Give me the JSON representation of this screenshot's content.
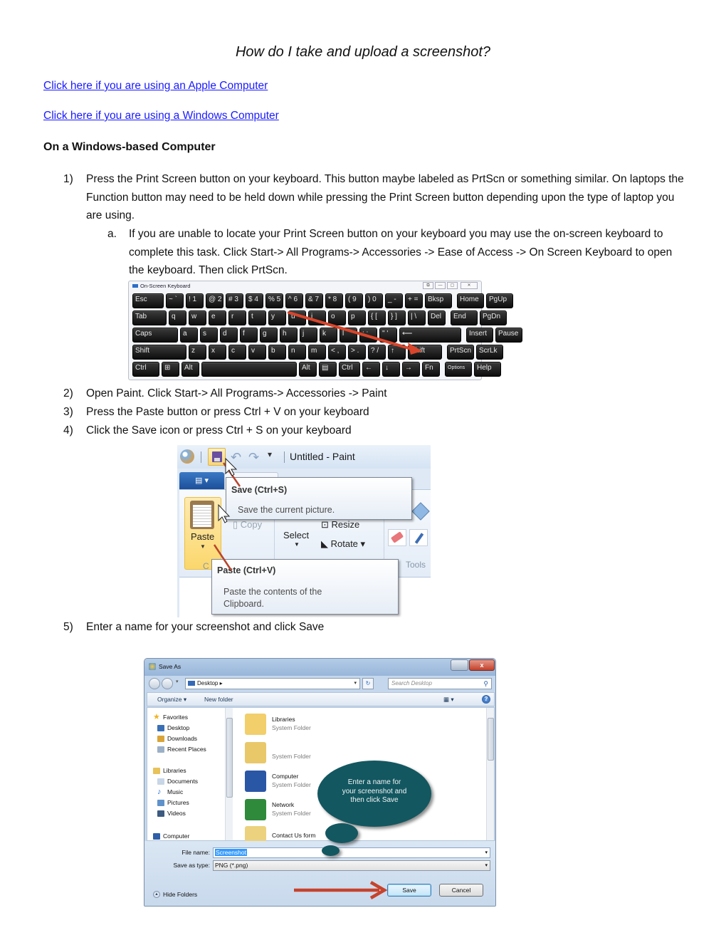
{
  "document": {
    "title": "How do I take and upload a screenshot?",
    "links": [
      {
        "label": "Click here if you are using an Apple Computer"
      },
      {
        "label": "Click here if you are using a Windows Computer"
      }
    ],
    "section_heading": "On a Windows-based Computer",
    "steps": [
      {
        "num": "1)",
        "text": "Press the Print Screen button on your keyboard. This button maybe labeled as PrtScn or something similar. On laptops the Function button may need to be held down while pressing the Print Screen button depending upon the type of laptop you are using."
      },
      {
        "num": "2)",
        "text": "Open Paint. Click Start-> All Programs-> Accessories -> Paint"
      },
      {
        "num": "3)",
        "text": "Press the Paste button or press Ctrl + V on your keyboard"
      },
      {
        "num": "4)",
        "text": "Click the Save icon or press Ctrl + S on your keyboard"
      },
      {
        "num": "5)",
        "text": "Enter a name for your screenshot and click Save"
      }
    ],
    "substep": {
      "num": "a.",
      "text": "If you are unable to locate your Print Screen button on your keyboard you may use the on-screen keyboard to complete this task. Click Start-> All Programs-> Accessories -> Ease of Access -> On Screen Keyboard to open the keyboard. Then click PrtScn."
    }
  },
  "keyboard": {
    "window_title": "On-Screen Keyboard",
    "highlight_color": "#d9452b",
    "rows": [
      [
        "Esc",
        "~ `",
        "! 1",
        "@ 2",
        "# 3",
        "$ 4",
        "% 5",
        "^ 6",
        "& 7",
        "* 8",
        "( 9",
        ") 0",
        "_ -",
        "+ =",
        "Bksp",
        "Home",
        "PgUp"
      ],
      [
        "Tab",
        "q",
        "w",
        "e",
        "r",
        "t",
        "y",
        "u",
        "i",
        "o",
        "p",
        "{ [",
        "} ]",
        "| \\",
        "Del",
        "End",
        "PgDn"
      ],
      [
        "Caps",
        "a",
        "s",
        "d",
        "f",
        "g",
        "h",
        "j",
        "k",
        "l",
        ": ;",
        "\" '",
        "⟵",
        "Insert",
        "Pause"
      ],
      [
        "Shift",
        "z",
        "x",
        "c",
        "v",
        "b",
        "n",
        "m",
        "< ,",
        "> .",
        "? /",
        "↑",
        "Shift",
        "PrtScn",
        "ScrLk"
      ],
      [
        "Ctrl",
        "⊞",
        "Alt",
        "",
        "Alt",
        "▤",
        "Ctrl",
        "←",
        "↓",
        "→",
        "Fn",
        "Options",
        "Help"
      ]
    ]
  },
  "paint": {
    "window_title": "Untitled - Paint",
    "ribbon": {
      "paste": "Paste",
      "copy": "Copy",
      "select": "Select",
      "resize": "Resize",
      "rotate": "Rotate ▾",
      "group_clipboard": "C",
      "group_tools": "Tools"
    },
    "tooltips": {
      "save_title": "Save (Ctrl+S)",
      "save_desc": "Save the current picture.",
      "paste_title": "Paste (Ctrl+V)",
      "paste_desc_1": "Paste the contents of the",
      "paste_desc_2": "Clipboard."
    }
  },
  "save_dialog": {
    "window_title": "Save As",
    "address": "Desktop",
    "search_placeholder": "Search Desktop",
    "toolbar": {
      "organize": "Organize ▾",
      "new_folder": "New folder"
    },
    "nav_tree": [
      {
        "label": "Favorites",
        "icon": "star-icon",
        "color": "#f0b323"
      },
      {
        "label": "Desktop",
        "icon": "desktop-icon",
        "color": "#3a6fb6"
      },
      {
        "label": "Downloads",
        "icon": "downloads-icon",
        "color": "#d9a53a"
      },
      {
        "label": "Recent Places",
        "icon": "recent-places-icon",
        "color": "#9bb0c7"
      },
      {
        "label": "Libraries",
        "icon": "libraries-icon",
        "color": "#e8c25a"
      },
      {
        "label": "Documents",
        "icon": "documents-icon",
        "color": "#c8d6e6"
      },
      {
        "label": "Music",
        "icon": "music-icon",
        "color": "#2b78d0"
      },
      {
        "label": "Pictures",
        "icon": "pictures-icon",
        "color": "#5f92c9"
      },
      {
        "label": "Videos",
        "icon": "videos-icon",
        "color": "#3d5a80"
      },
      {
        "label": "Computer",
        "icon": "computer-icon",
        "color": "#2e5fa8"
      }
    ],
    "files": [
      {
        "name": "Libraries",
        "type": "System Folder",
        "color": "#f2cf6a"
      },
      {
        "name": "",
        "type": "System Folder",
        "color": "#e9c86a"
      },
      {
        "name": "Computer",
        "type": "System Folder",
        "color": "#2a56a6"
      },
      {
        "name": "Network",
        "type": "System Folder",
        "color": "#2f8a3b"
      },
      {
        "name": "Contact Us form",
        "type": "",
        "color": "#ecd27f"
      }
    ],
    "file_name_label": "File name:",
    "file_name_value": "Screenshot",
    "save_type_label": "Save as type:",
    "save_type_value": "PNG (*.png)",
    "hide_folders": "Hide Folders",
    "save_button": "Save",
    "cancel_button": "Cancel",
    "callout": {
      "line1": "Enter a name for",
      "line2": "your screenshot and",
      "line3": "then click Save",
      "color": "#135760"
    }
  }
}
